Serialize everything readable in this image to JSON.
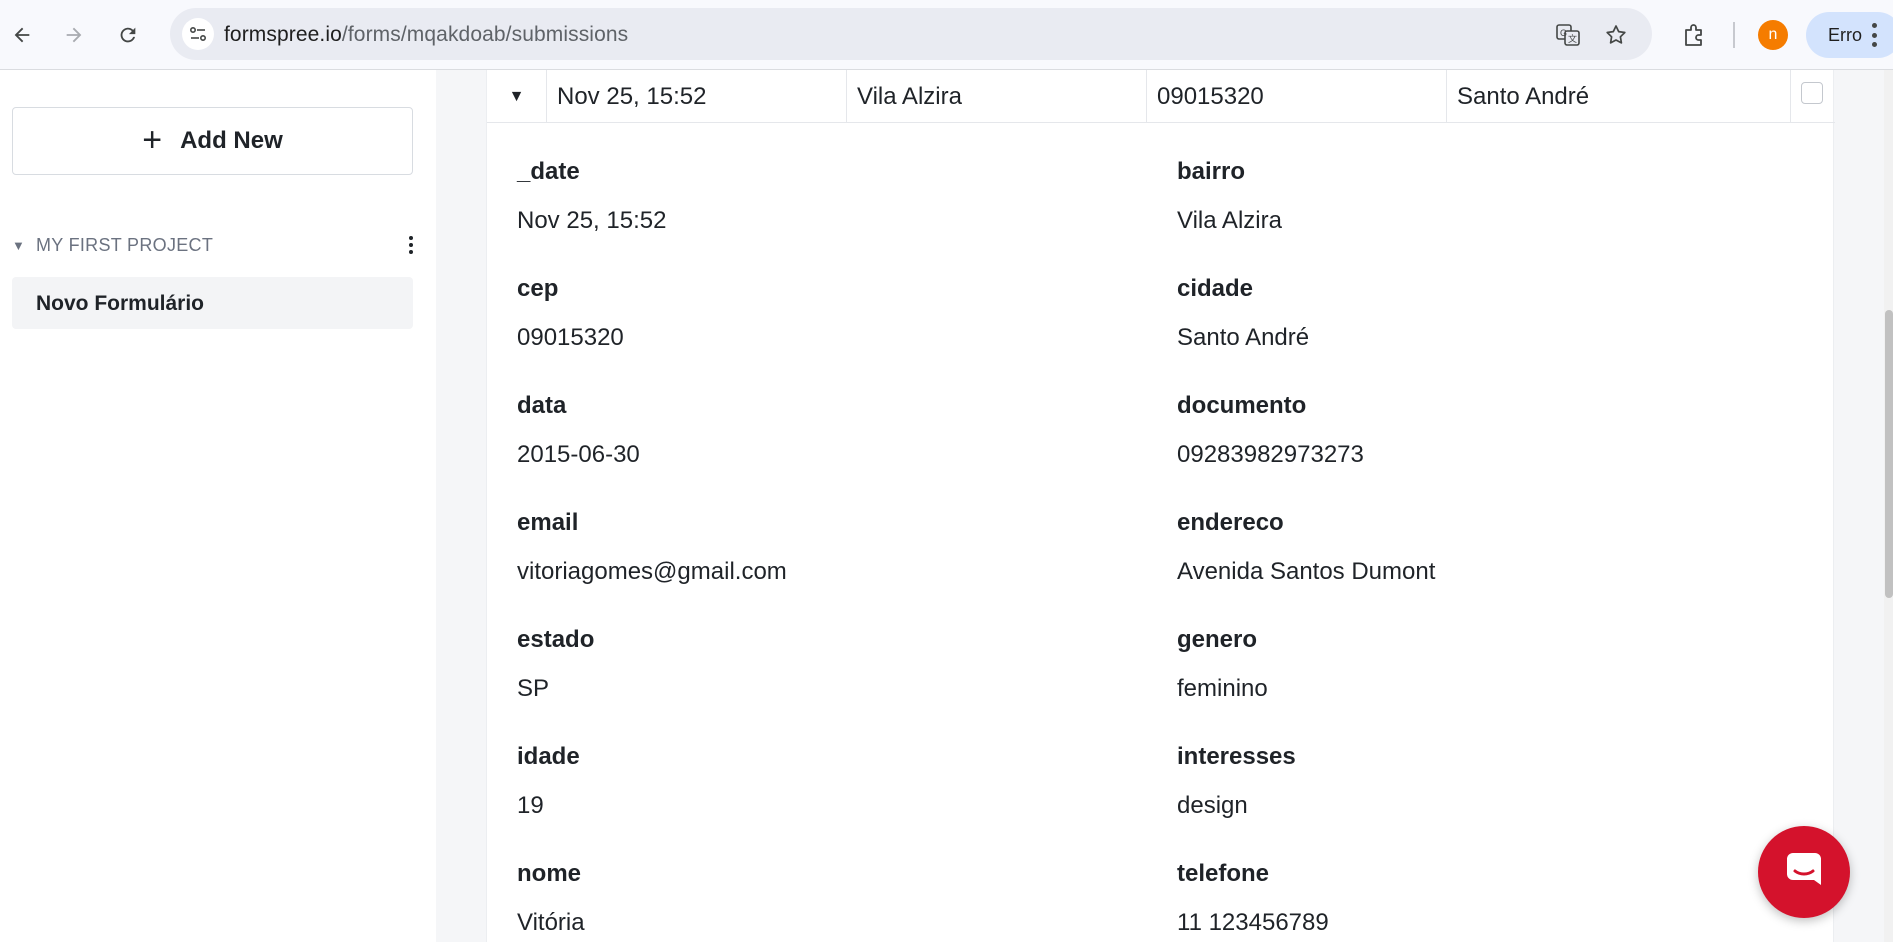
{
  "browser": {
    "url_host": "formspree.io",
    "url_path": "/forms/mqakdoab/submissions",
    "avatar_letter": "n",
    "profile_label": "Erro",
    "icons": [
      "back-arrow-icon",
      "forward-arrow-icon",
      "reload-icon",
      "site-settings-icon",
      "translate-icon",
      "bookmark-star-icon",
      "extensions-icon",
      "menu-kebab-icon"
    ]
  },
  "sidebar": {
    "add_new_label": "Add New",
    "project_name": "MY FIRST PROJECT",
    "forms": [
      {
        "label": "Novo Formulário"
      }
    ]
  },
  "submission": {
    "row": {
      "date": "Nov 25, 15:52",
      "bairro": "Vila Alzira",
      "cep": "09015320",
      "cidade": "Santo André",
      "expanded": true,
      "selected": false
    },
    "fields": [
      {
        "name": "_date",
        "value": "Nov 25, 15:52"
      },
      {
        "name": "bairro",
        "value": "Vila Alzira"
      },
      {
        "name": "cep",
        "value": "09015320"
      },
      {
        "name": "cidade",
        "value": "Santo André"
      },
      {
        "name": "data",
        "value": "2015-06-30"
      },
      {
        "name": "documento",
        "value": "09283982973273"
      },
      {
        "name": "email",
        "value": "vitoriagomes@gmail.com"
      },
      {
        "name": "endereco",
        "value": "Avenida Santos Dumont"
      },
      {
        "name": "estado",
        "value": "SP"
      },
      {
        "name": "genero",
        "value": "feminino"
      },
      {
        "name": "idade",
        "value": "19"
      },
      {
        "name": "interesses",
        "value": "design"
      },
      {
        "name": "nome",
        "value": "Vitória"
      },
      {
        "name": "telefone",
        "value": "11 123456789"
      }
    ]
  },
  "colors": {
    "accent_red": "#d4122c",
    "avatar_orange": "#f57c00",
    "profile_pill": "#d3e3fd"
  }
}
